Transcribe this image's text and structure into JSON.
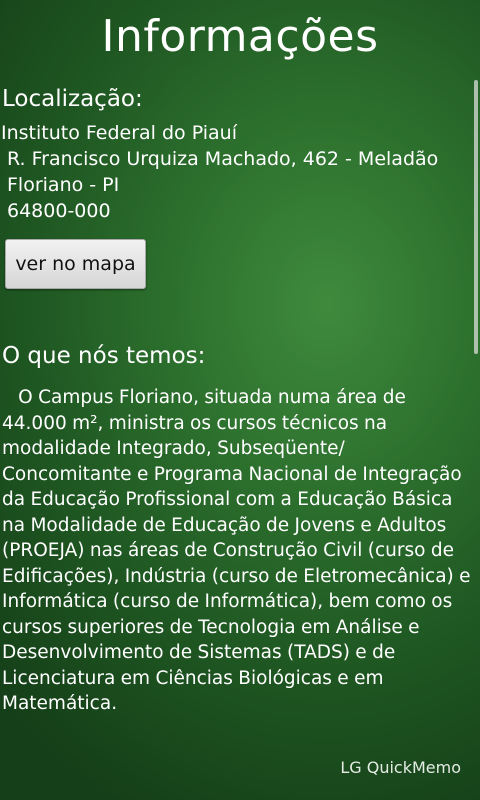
{
  "header": {
    "title": "Informações"
  },
  "location": {
    "heading": "Localização:",
    "institution": "Instituto Federal do Piauí",
    "street": "R. Francisco Urquiza Machado, 462 - Meladão",
    "city": "Floriano - PI",
    "zip": "64800-000",
    "map_button_label": "ver no mapa"
  },
  "about": {
    "heading": "O que nós temos:",
    "text": "   O Campus Floriano, situada numa área de 44.000 m², ministra os cursos técnicos na modalidade Integrado, Subseqüente/ Concomitante e Programa Nacional de Integração da Educação Profissional com a Educação Básica na Modalidade de Educação de Jovens e Adultos (PROEJA) nas áreas de Construção Civil (curso de Edificações), Indústria (curso de Eletromecânica) e Informática (curso de Informática), bem como os cursos superiores de Tecnologia em Análise e Desenvolvimento de Sistemas (TADS) e de Licenciatura em Ciências Biológicas e em Matemática."
  },
  "watermark": {
    "label": "LG QuickMemo"
  }
}
